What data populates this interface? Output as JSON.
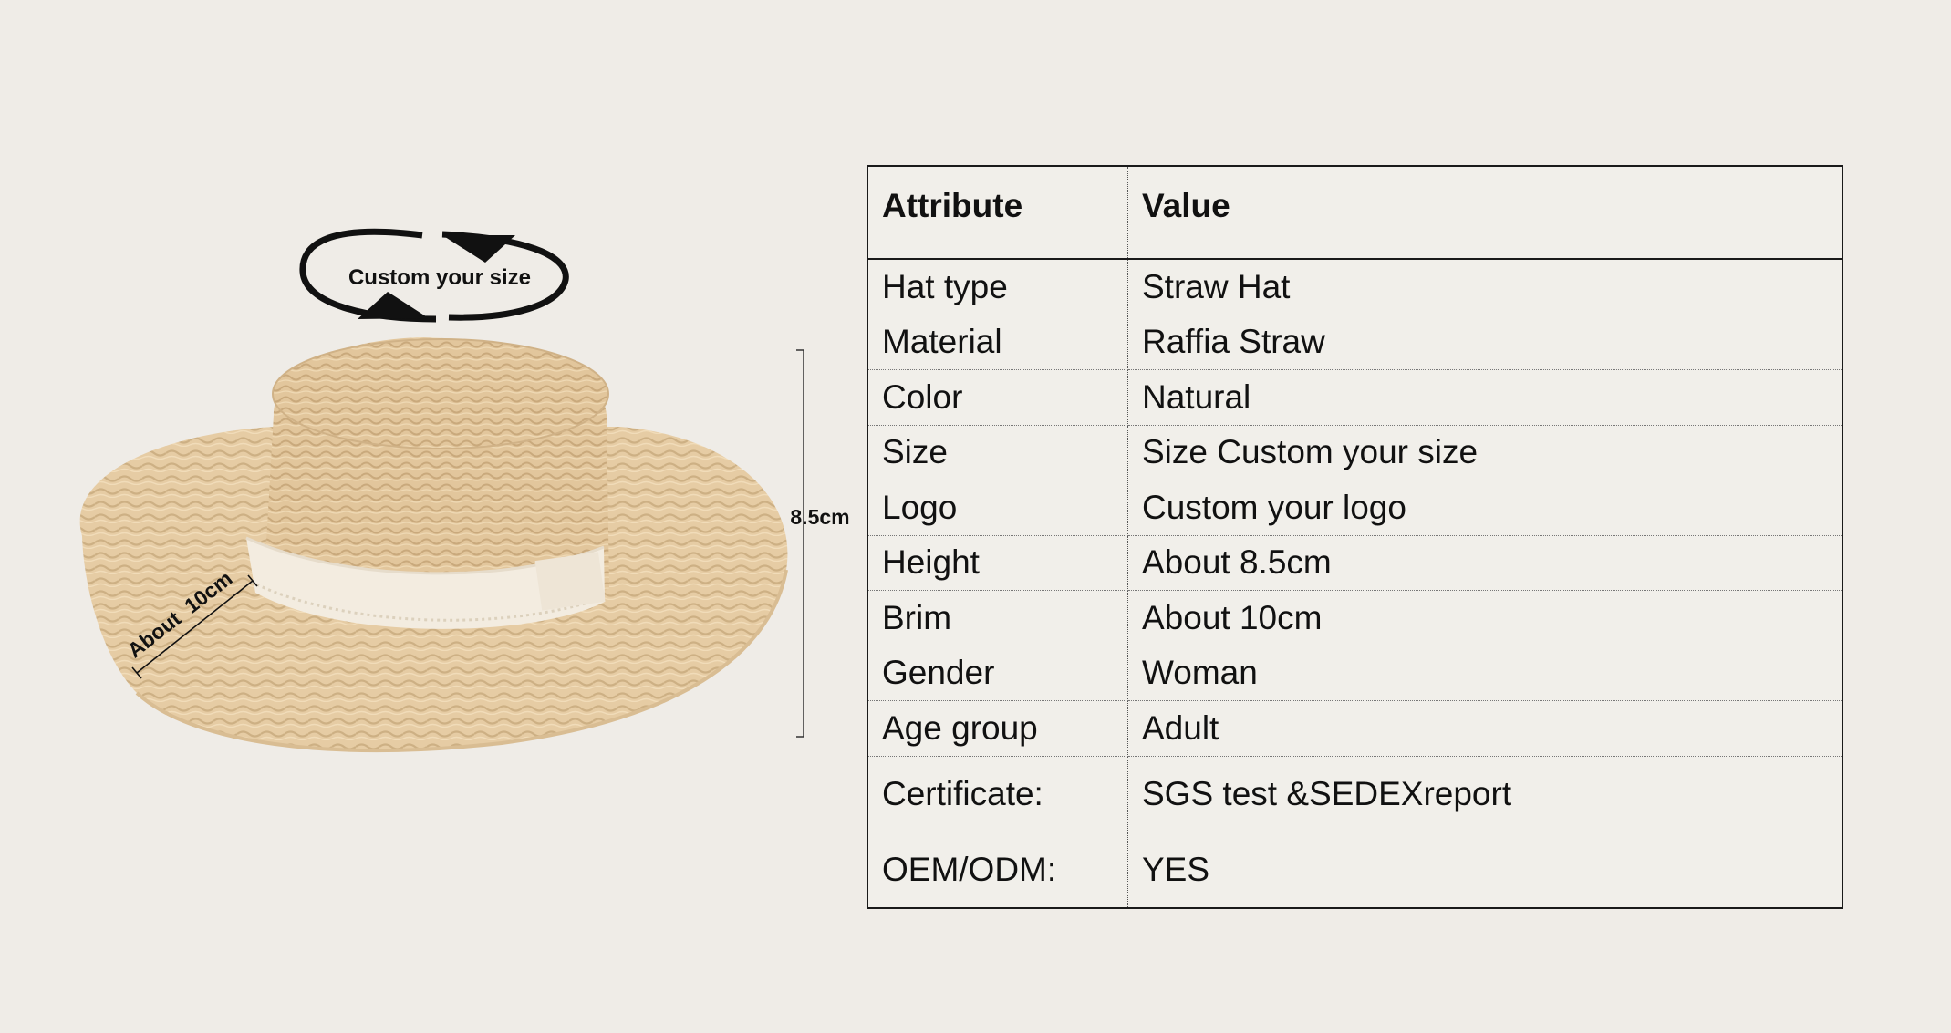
{
  "figure": {
    "size_label": "Custom your size",
    "height_label": "8.5cm",
    "brim_label": "About  10cm"
  },
  "table": {
    "headers": [
      "Attribute",
      "Value"
    ],
    "rows": [
      {
        "attribute": "Hat type",
        "value": "Straw Hat"
      },
      {
        "attribute": "Material",
        "value": "Raffia Straw"
      },
      {
        "attribute": "Color",
        "value": "Natural"
      },
      {
        "attribute": "Size",
        "value": "Size Custom your size"
      },
      {
        "attribute": "Logo",
        "value": "Custom your logo"
      },
      {
        "attribute": "Height",
        "value": "About 8.5cm"
      },
      {
        "attribute": "Brim",
        "value": "About 10cm"
      },
      {
        "attribute": "Gender",
        "value": "Woman"
      },
      {
        "attribute": "Age group",
        "value": "Adult"
      },
      {
        "attribute": "Certificate:",
        "value": "SGS test &SEDEXreport"
      },
      {
        "attribute": "OEM/ODM:",
        "value": "YES"
      }
    ]
  },
  "colors": {
    "background": "#efece7",
    "straw": "#e8cfa8",
    "ribbon": "#f3ece0"
  }
}
